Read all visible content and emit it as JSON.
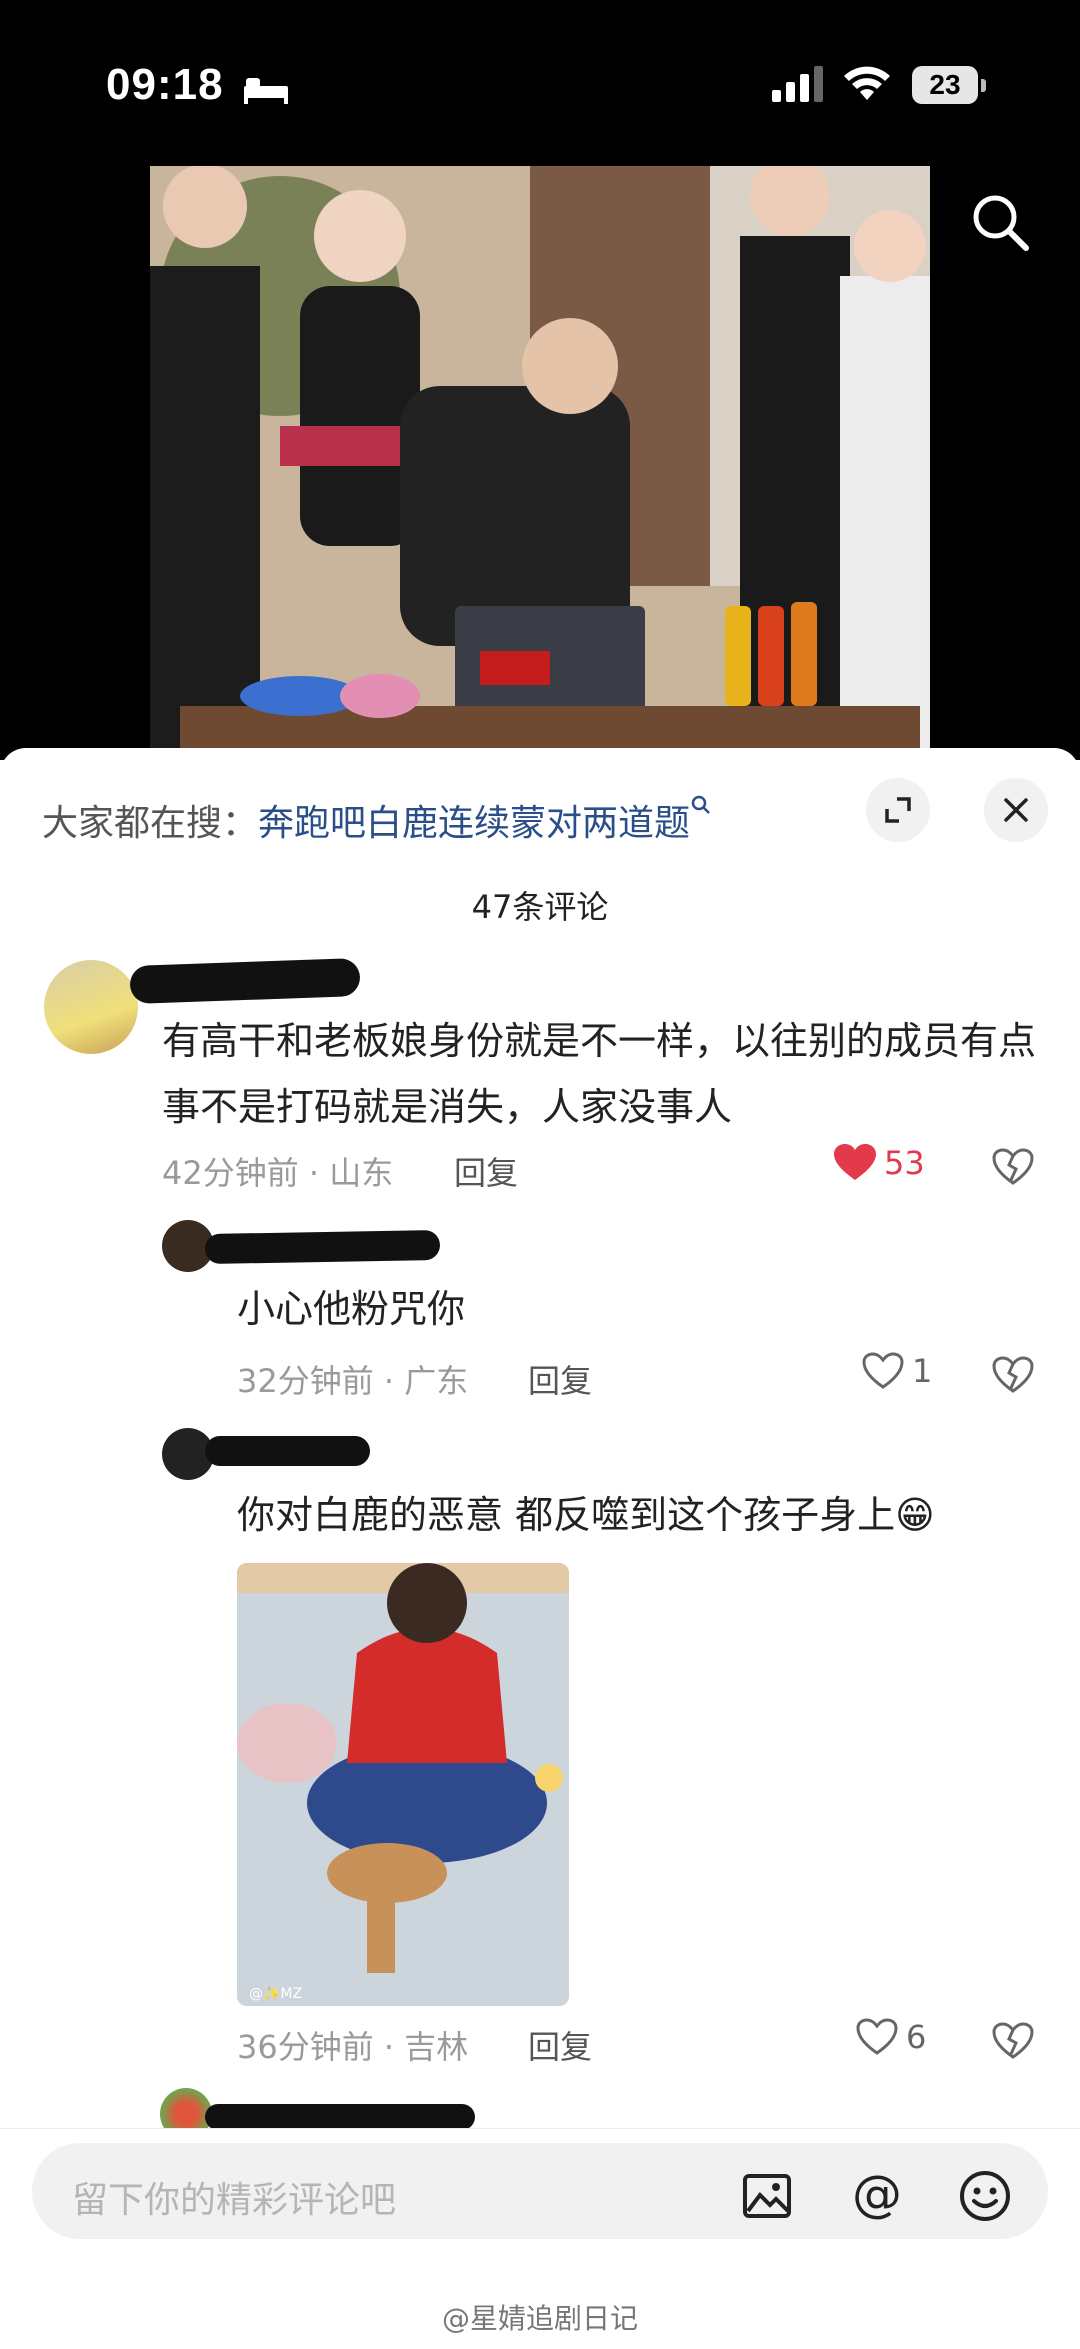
{
  "status_bar": {
    "time": "09:18",
    "battery": "23"
  },
  "sheet": {
    "trending_label": "大家都在搜：",
    "trending_keyword": "奔跑吧白鹿连续蒙对两道题",
    "comment_count": "47条评论"
  },
  "comments": [
    {
      "text": "有高干和老板娘身份就是不一样，以往别的成员有点事不是打码就是消失，人家没事人",
      "time_location": "42分钟前 · 山东",
      "reply": "回复",
      "likes": "53"
    },
    {
      "text": "小心他粉咒你",
      "time_location": "32分钟前 · 广东",
      "reply": "回复",
      "likes": "1"
    },
    {
      "text": "你对白鹿的恶意 都反噬到这个孩子身上😁",
      "time_location": "36分钟前 · 吉林",
      "reply": "回复",
      "likes": "6",
      "image_caption": "@✨MZ"
    }
  ],
  "input": {
    "placeholder": "留下你的精彩评论吧"
  },
  "watermark": "@星婧追剧日记",
  "colors": {
    "liked_heart": "#e2394b",
    "link_blue": "#2a4e88",
    "meta_gray": "#9a9a9a"
  }
}
